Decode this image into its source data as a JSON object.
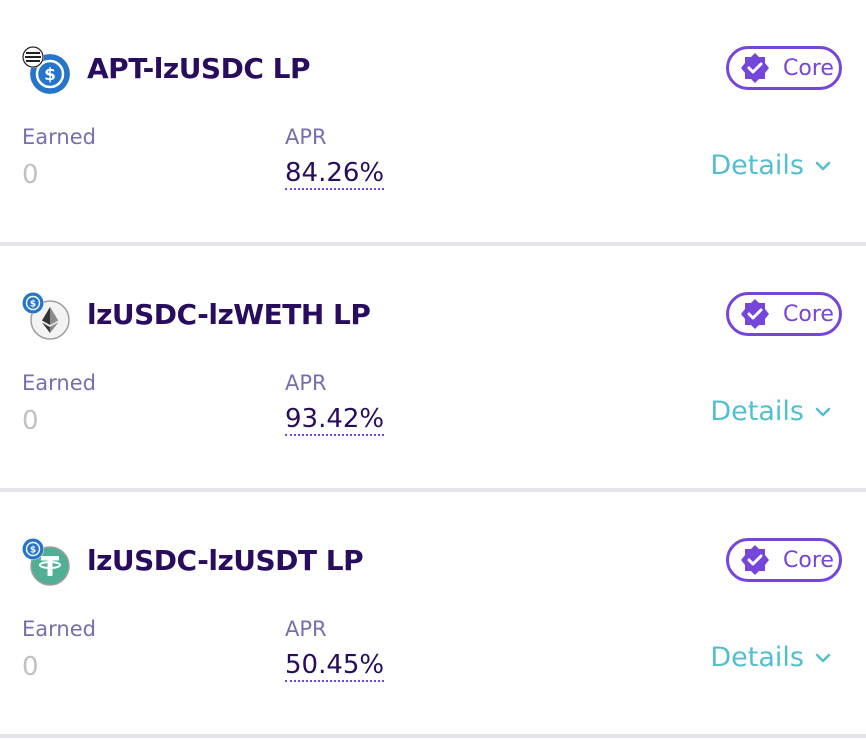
{
  "farms": [
    {
      "name": "APT-lzUSDC LP",
      "badge": "Core",
      "earned_label": "Earned",
      "earned_value": "0",
      "apr_label": "APR",
      "apr_value": "84.26%",
      "details_label": "Details",
      "token_small": "aptos-icon",
      "token_big": "usdc-icon"
    },
    {
      "name": "lzUSDC-lzWETH LP",
      "badge": "Core",
      "earned_label": "Earned",
      "earned_value": "0",
      "apr_label": "APR",
      "apr_value": "93.42%",
      "details_label": "Details",
      "token_small": "usdc-icon",
      "token_big": "weth-icon"
    },
    {
      "name": "lzUSDC-lzUSDT LP",
      "badge": "Core",
      "earned_label": "Earned",
      "earned_value": "0",
      "apr_label": "APR",
      "apr_value": "50.45%",
      "details_label": "Details",
      "token_small": "usdc-icon",
      "token_big": "usdt-icon"
    }
  ],
  "colors": {
    "title": "#280d5f",
    "secondary": "#7a6eaa",
    "accent": "#7645d9",
    "link": "#52bfd0",
    "muted": "#bdc2c4"
  }
}
